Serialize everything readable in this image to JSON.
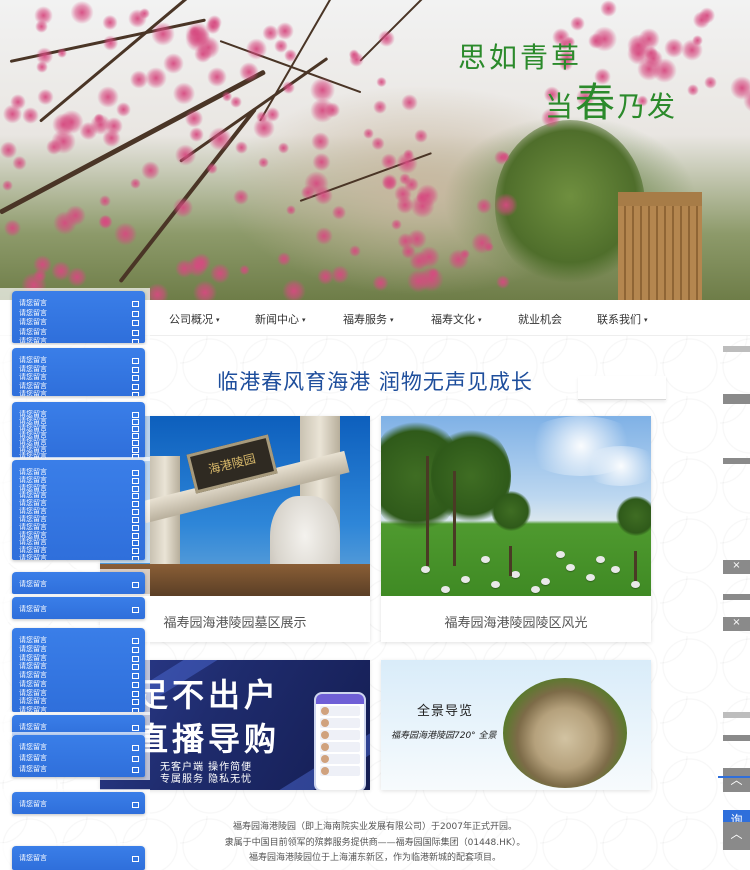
{
  "hero": {
    "poem_line1": "思如青草",
    "poem_line2_pre": "当",
    "poem_line2_big": "春",
    "poem_line2_post": "乃发"
  },
  "nav": {
    "items": [
      {
        "label": "公司概况",
        "has_dropdown": true
      },
      {
        "label": "新闻中心",
        "has_dropdown": true
      },
      {
        "label": "福寿服务",
        "has_dropdown": true
      },
      {
        "label": "福寿文化",
        "has_dropdown": true
      },
      {
        "label": "就业机会",
        "has_dropdown": false
      },
      {
        "label": "联系我们",
        "has_dropdown": true
      }
    ],
    "caret": "▾"
  },
  "headline": "临港春风育海港  润物无声见成长",
  "cards": [
    {
      "caption": "福寿园海港陵园墓区展示",
      "plaque": "海港陵园"
    },
    {
      "caption": "福寿园海港陵园陵区风光"
    },
    {
      "promo_line1": "足不出户",
      "promo_line2": "直播导购",
      "promo_small1": "无客户端  操作简便",
      "promo_small2": "专属服务  隐私无忧"
    },
    {
      "pano_title": "全景导览",
      "pano_sub": "福寿园海港陵园720° 全景"
    }
  ],
  "footer": {
    "lines": [
      "福寿园海港陵园（即上海南院实业发展有限公司）于2007年正式开园。",
      "隶属于中国目前领军的殡葬服务提供商——福寿园国际集团（01448.HK）。",
      "福寿园海港陵园位于上海浦东新区，作为临港新城的配套项目。"
    ]
  },
  "message_widget": {
    "label": "请您留言"
  },
  "right_tabs": {
    "close_symbol": "×",
    "up_symbol": "︿",
    "chat_label": "询"
  },
  "colors": {
    "accent": "#1e4e9c",
    "widget_blue": "#2f6fdb",
    "poem_green": "#2b8a2b"
  }
}
